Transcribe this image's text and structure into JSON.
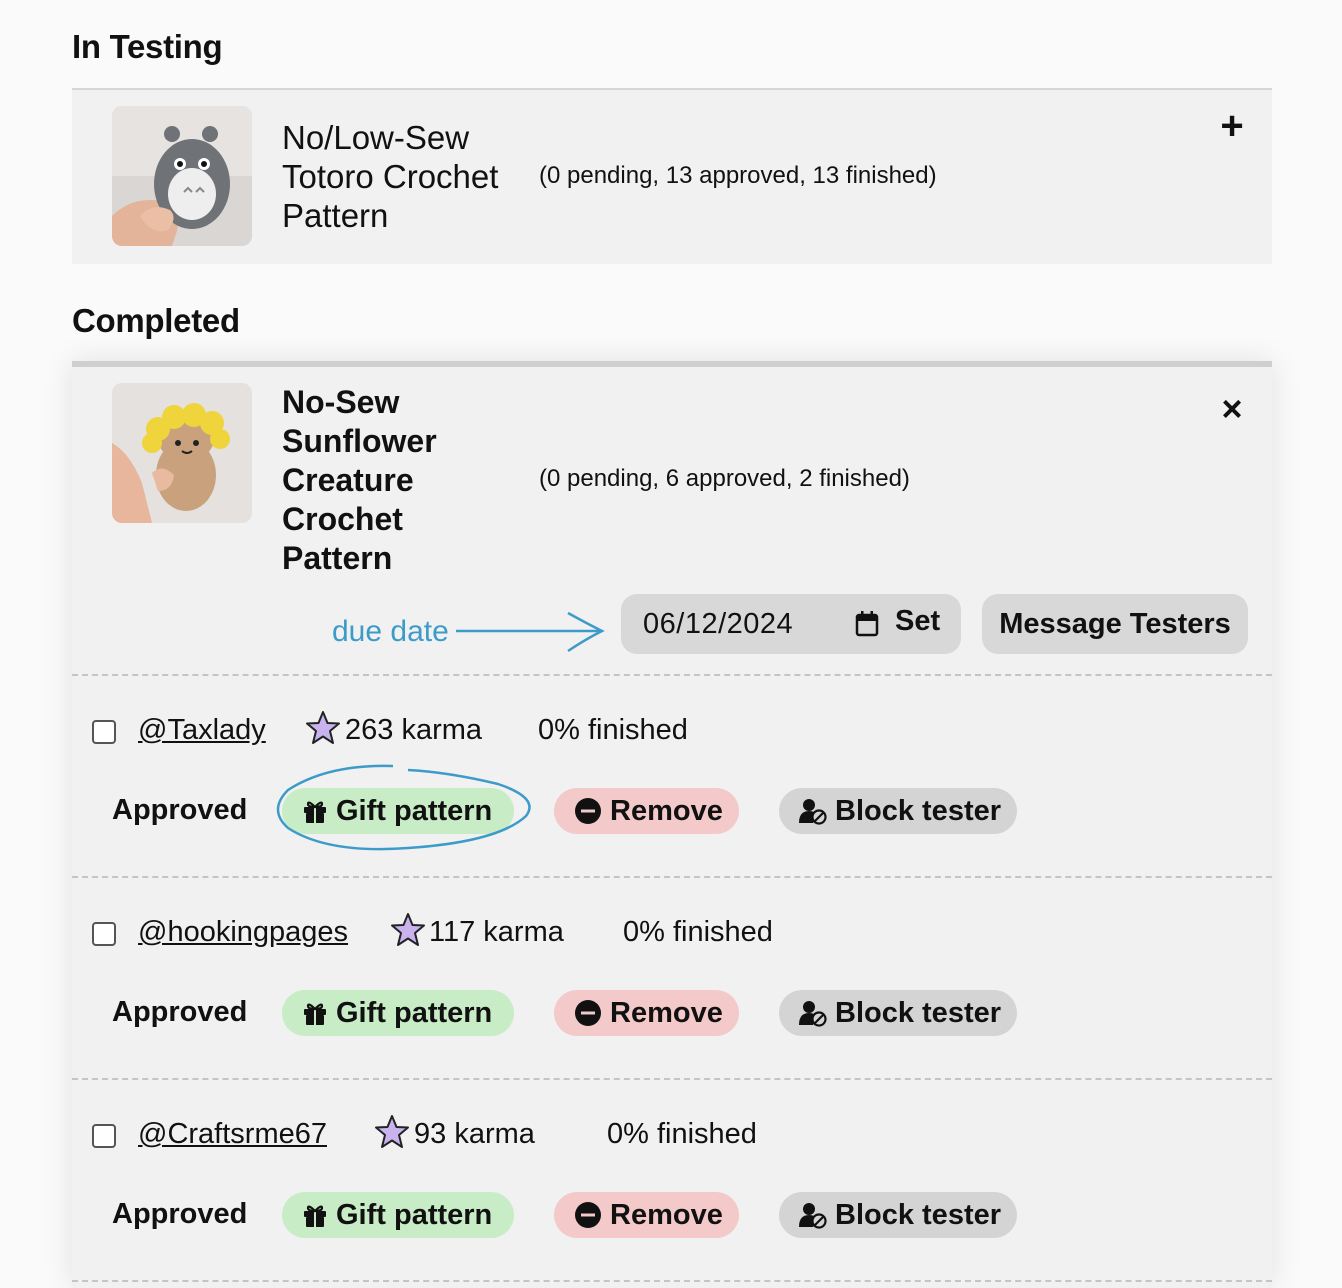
{
  "sections": {
    "in_testing": "In Testing",
    "completed": "Completed"
  },
  "in_testing_item": {
    "title": "No/Low-Sew Totoro Crochet Pattern",
    "counts": "(0 pending, 13 approved, 13 finished)",
    "expand_label": "+"
  },
  "completed_item": {
    "title": "No-Sew Sunflower Creature Crochet Pattern",
    "counts": "(0 pending, 6 approved, 2 finished)",
    "close_label": "×",
    "annotation": "due date",
    "due_date": "06/12/2024",
    "set_label": "Set",
    "message_label": "Message Testers"
  },
  "testers": [
    {
      "handle": "@Taxlady",
      "karma": "263 karma",
      "finished": "0% finished",
      "status": "Approved",
      "checked": false
    },
    {
      "handle": "@hookingpages",
      "karma": "117 karma",
      "finished": "0% finished",
      "status": "Approved",
      "checked": false
    },
    {
      "handle": "@Craftsrme67",
      "karma": "93 karma",
      "finished": "0% finished",
      "status": "Approved",
      "checked": false
    }
  ],
  "actions": {
    "gift": "Gift pattern",
    "remove": "Remove",
    "block": "Block tester"
  },
  "colors": {
    "gift_bg": "#c8ecc6",
    "remove_bg": "#f3c9c9",
    "block_bg": "#d4d4d4",
    "annotation": "#3d9bc9",
    "star_fill": "#c9b3ee"
  },
  "icons": {
    "expand": "plus-icon",
    "close": "close-icon",
    "calendar": "calendar-icon",
    "karma": "star-icon",
    "gift": "gift-icon",
    "remove": "minus-circle-icon",
    "block": "user-block-icon"
  }
}
